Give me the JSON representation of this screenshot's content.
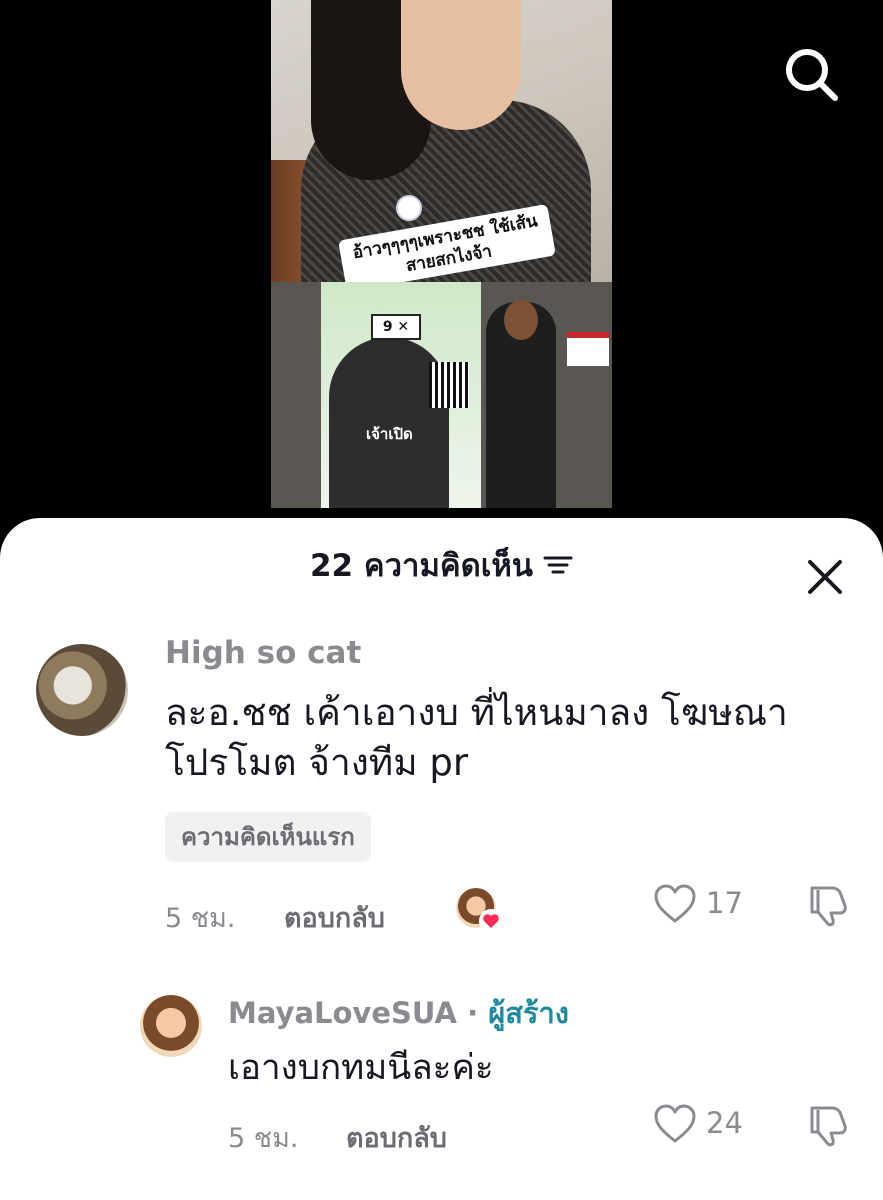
{
  "video": {
    "caption": "อ้าวๆๆๆๆเพราะชช ใช้เส้นสายสกไงจ้า",
    "poster_label": "เจ้าเปิด",
    "poster_number": "9 ✕"
  },
  "header": {
    "comment_count_title": "22 ความคิดเห็น"
  },
  "comments": [
    {
      "username": "High so cat",
      "text": "ละอ.ชช เค้าเอางบ ที่ไหนมาลง โฆษณา โปรโมต จ้างทีม pr",
      "badge": "ความคิดเห็นแรก",
      "time": "5 ชม.",
      "reply_label": "ตอบกลับ",
      "likes": "17"
    },
    {
      "username": "MayaLoveSUA",
      "separator": "·",
      "creator_label": "ผู้สร้าง",
      "text": "เอางบกทมนีละค่ะ",
      "time": "5 ชม.",
      "reply_label": "ตอบกลับ",
      "likes": "24"
    }
  ],
  "icons": {
    "search": "search-icon",
    "filter": "filter-icon",
    "close": "close-icon",
    "like": "heart-outline-icon",
    "dislike": "thumbs-down-icon",
    "creator_liked": "heart-badge-icon"
  },
  "colors": {
    "creator_accent": "#1e8a9e",
    "liked_heart": "#fe2c55"
  }
}
